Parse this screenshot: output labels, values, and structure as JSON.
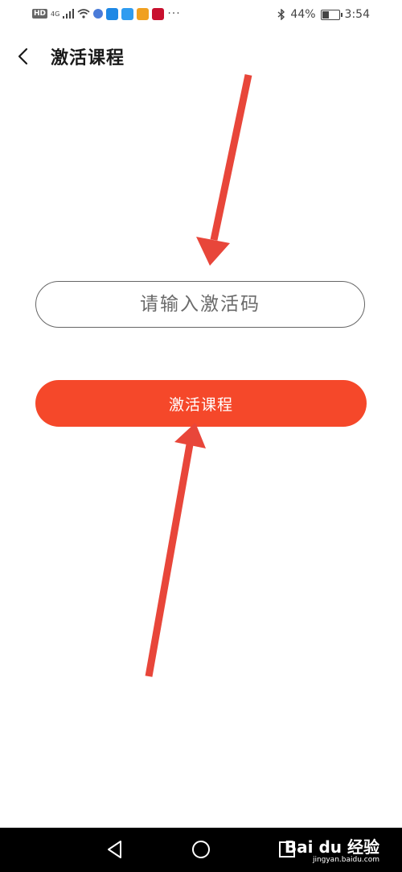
{
  "status_bar": {
    "network": "4G",
    "hd": "HD",
    "more": "···",
    "battery_percent": "44%",
    "battery_level": 0.44,
    "time": "3:54"
  },
  "header": {
    "title": "激活课程"
  },
  "form": {
    "code_placeholder": "请输入激活码",
    "code_value": "",
    "submit_label": "激活课程"
  },
  "watermark": {
    "main": "Bai du 经验",
    "sub": "jingyan.baidu.com"
  },
  "colors": {
    "accent": "#f5482a",
    "arrow": "#e8463a"
  }
}
